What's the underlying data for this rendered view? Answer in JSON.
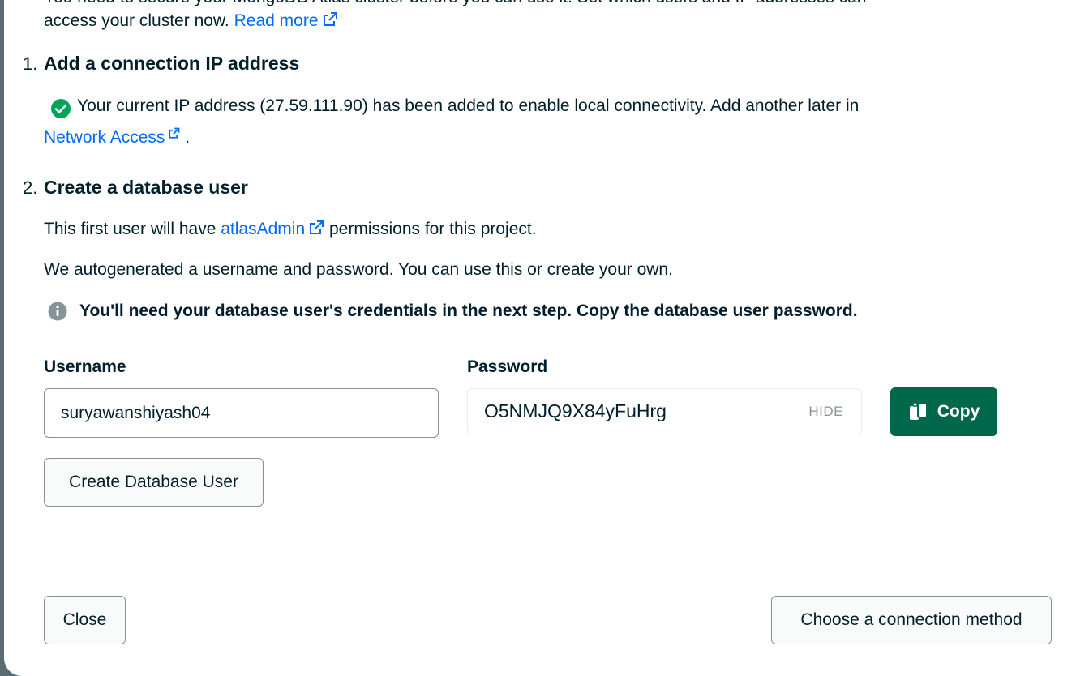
{
  "intro": {
    "clipped_text": "You need to secure your MongoDB Atlas cluster before you can use it. Set which users and IP addresses can",
    "text": "access your cluster now.",
    "read_more": "Read more"
  },
  "step1": {
    "number": "1.",
    "title": "Add a connection IP address",
    "message": "Your current IP address (27.59.111.90) has been added to enable local connectivity. Add another later in",
    "link": "Network Access",
    "tail": "."
  },
  "step2": {
    "number": "2.",
    "title": "Create a database user",
    "perm_prefix": "This first user will have",
    "perm_link": "atlasAdmin",
    "perm_suffix": "permissions for this project.",
    "autogen": "We autogenerated a username and password. You can use this or create your own.",
    "info": "You'll need your database user's credentials in the next step. Copy the database user password."
  },
  "form": {
    "username_label": "Username",
    "username_value": "suryawanshiyash04",
    "password_label": "Password",
    "password_value": "O5NMJQ9X84yFuHrg",
    "hide_label": "HIDE",
    "copy_label": "Copy",
    "create_user_label": "Create Database User"
  },
  "footer": {
    "close_label": "Close",
    "next_label": "Choose a connection method"
  },
  "colors": {
    "link": "#016bf8",
    "primary": "#00684a",
    "success": "#00a35c",
    "overlay": "#5c6c75"
  },
  "icons": {
    "external": "external-link-icon",
    "check": "check-circle-icon",
    "info": "info-icon",
    "copy": "copy-icon"
  }
}
